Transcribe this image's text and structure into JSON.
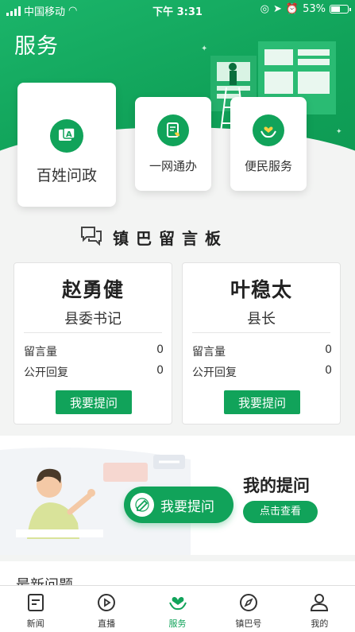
{
  "status_bar": {
    "carrier": "中国移动",
    "time": "下午 3:31",
    "battery": "53%"
  },
  "header": {
    "title": "服务"
  },
  "services": [
    {
      "label": "百姓问政",
      "icon": "chat-a-icon"
    },
    {
      "label": "一网通办",
      "icon": "document-leaf-icon"
    },
    {
      "label": "便民服务",
      "icon": "hands-heart-icon"
    }
  ],
  "board": {
    "title": "镇巴留言板",
    "leaders": [
      {
        "name": "赵勇健",
        "title": "县委书记",
        "msg_label": "留言量",
        "msg_count": "0",
        "reply_label": "公开回复",
        "reply_count": "0",
        "button": "我要提问"
      },
      {
        "name": "叶稳太",
        "title": "县长",
        "msg_label": "留言量",
        "msg_count": "0",
        "reply_label": "公开回复",
        "reply_count": "0",
        "button": "我要提问"
      }
    ]
  },
  "my_questions": {
    "ask_button": "我要提问",
    "title": "我的提问",
    "view_button": "点击查看"
  },
  "latest": {
    "title": "最新问题"
  },
  "tabbar": {
    "active_color": "#11a35a",
    "items": [
      {
        "label": "新闻",
        "icon": "news-icon"
      },
      {
        "label": "直播",
        "icon": "play-icon"
      },
      {
        "label": "服务",
        "icon": "heart-hands-icon",
        "active": true
      },
      {
        "label": "镇巴号",
        "icon": "compass-icon"
      },
      {
        "label": "我的",
        "icon": "user-icon"
      }
    ]
  },
  "colors": {
    "brand_green": "#11a35a",
    "background": "#f3f4f3"
  }
}
